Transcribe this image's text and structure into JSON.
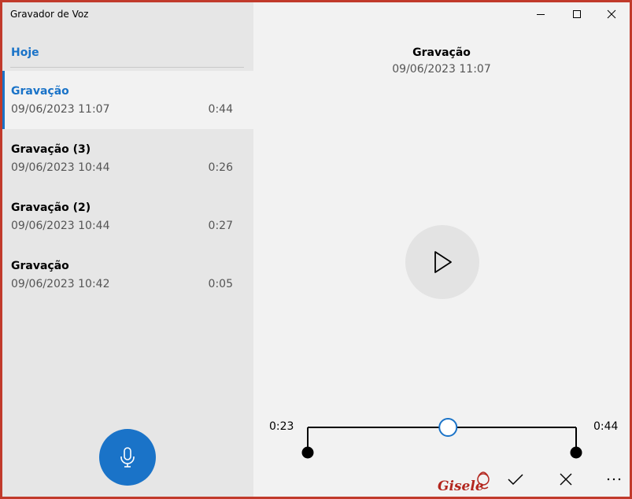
{
  "app": {
    "title": "Gravador de Voz"
  },
  "sidebar": {
    "group_header": "Hoje",
    "recordings": [
      {
        "name": "Gravação",
        "date": "09/06/2023 11:07",
        "duration": "0:44",
        "selected": true
      },
      {
        "name": "Gravação (3)",
        "date": "09/06/2023 10:44",
        "duration": "0:26",
        "selected": false
      },
      {
        "name": "Gravação (2)",
        "date": "09/06/2023 10:44",
        "duration": "0:27",
        "selected": false
      },
      {
        "name": "Gravação",
        "date": "09/06/2023 10:42",
        "duration": "0:05",
        "selected": false
      }
    ],
    "record_icon": "microphone-icon"
  },
  "player": {
    "title": "Gravação",
    "date": "09/06/2023 11:07",
    "current_time": "0:23",
    "total_time": "0:44",
    "progress_fraction": 0.5227,
    "trim_start_fraction": 0,
    "trim_end_fraction": 1,
    "play_icon": "play-icon"
  },
  "toolbar": {
    "icons": [
      "checkmark-icon",
      "close-icon",
      "more-icon"
    ]
  },
  "watermark": {
    "text": "Gisele"
  },
  "colors": {
    "accent": "#1a73c8",
    "frame": "#c13a2b",
    "sidebar_bg": "#e6e6e6",
    "main_bg": "#f2f2f2",
    "watermark": "#b3261e"
  }
}
